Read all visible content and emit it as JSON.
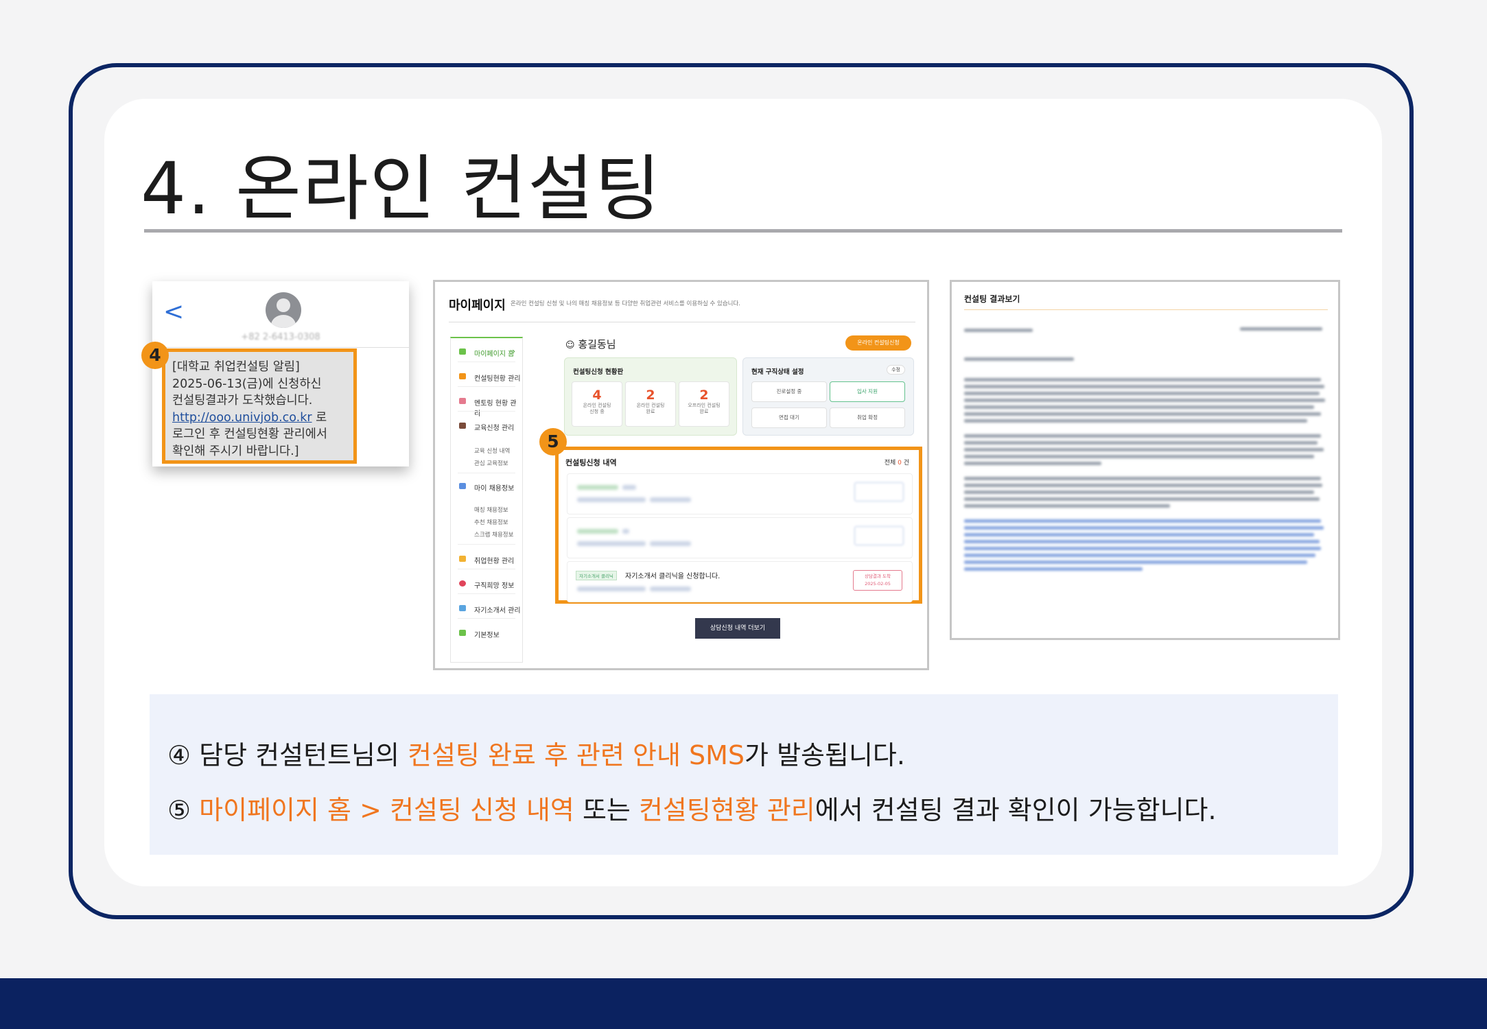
{
  "title": "4. 온라인 컨설팅",
  "sms": {
    "badge": "4",
    "back_glyph": "<",
    "phone_number": "+82 2-6413-0308",
    "line1": "[대학교 취업컨설팅 알림]",
    "line2": "2025-06-13(금)에 신청하신",
    "line3": "컨설팅결과가 도착했습니다.",
    "link": "http://ooo.univjob.co.kr",
    "line4_suffix": " 로",
    "line5": "로그인 후 컨설팅현황 관리에서",
    "line6": "확인해 주시기 바랍니다.]"
  },
  "mypage": {
    "heading": "마이페이지",
    "heading_sub": "온라인 컨설팅 신청 및 나의 매칭 채용정보 등 다양한 취업관련 서비스를 이용하실 수 있습니다.",
    "user": "홍길동님",
    "consult_button": "온라인 컨설팅신청",
    "sidebar": {
      "items": [
        {
          "label": "마이페이지 홈",
          "color": "#6cc24a",
          "active": true
        },
        {
          "label": "컨설팅현황 관리",
          "color": "#f29418"
        },
        {
          "label": "멘토링 현황 관리",
          "color": "#e57a8e"
        },
        {
          "label": "교육신청 관리",
          "color": "#7a4b3a"
        },
        {
          "label": "마이 채용정보",
          "color": "#5b8fe0"
        },
        {
          "label": "취업현황 관리",
          "color": "#f2b233"
        },
        {
          "label": "구직희망 정보",
          "color": "#e0445a"
        },
        {
          "label": "자기소개서 관리",
          "color": "#5aa5e0"
        },
        {
          "label": "기본정보",
          "color": "#6cc24a"
        }
      ],
      "sub_edu": [
        "교육 신청 내역",
        "관심 교육정보"
      ],
      "sub_job": [
        "매칭 채용정보",
        "추천 채용정보",
        "스크랩 채용정보"
      ]
    },
    "status": {
      "heading": "컨설팅신청 현황판",
      "stats": [
        {
          "value": "4",
          "label1": "온라인 컨설팅",
          "label2": "신청 중"
        },
        {
          "value": "2",
          "label1": "온라인 컨설팅",
          "label2": "완료"
        },
        {
          "value": "2",
          "label1": "오프라인 컨설팅",
          "label2": "완료"
        }
      ]
    },
    "job": {
      "heading": "현재 구직상태 설정",
      "edit": "수정",
      "buttons": [
        "진로설정 중",
        "입사 지원",
        "면접 대기",
        "취업 확정"
      ]
    },
    "history": {
      "badge": "5",
      "heading": "컨설팅신청 내역",
      "total_prefix": "전체 ",
      "total_count": "0",
      "total_suffix": " 건",
      "row3_tag": "자기소개서 클리닉",
      "row3_text": "자기소개서 클리닉을 신청합니다.",
      "row3_status": "상담결과 도착",
      "row3_date": "2025-02-05"
    },
    "more_button": "상담신청 내역 더보기"
  },
  "result": {
    "heading": "컨설팅 결과보기"
  },
  "explain": {
    "line1": {
      "prefix": "④ 담당 컨설턴트님의 ",
      "highlight": "컨설팅 완료 후 관련 안내 SMS",
      "suffix": "가 발송됩니다."
    },
    "line2": {
      "prefix": "⑤ ",
      "highlight1": "마이페이지 홈 > 컨설팅 신청 내역",
      "middle": " 또는 ",
      "highlight2": "컨설팅현황 관리",
      "suffix": "에서 컨설팅 결과 확인이 가능합니다."
    }
  },
  "colors": {
    "frame": "#0b2563",
    "accent": "#f0761f",
    "badge": "#f29418",
    "footer": "#0b2260"
  }
}
